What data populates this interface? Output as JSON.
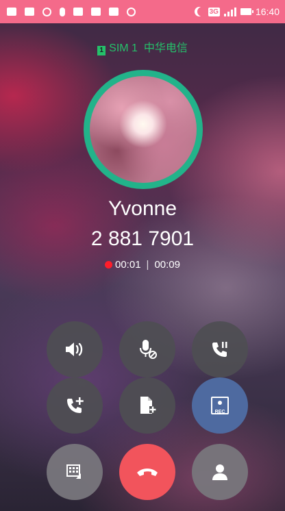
{
  "status_bar": {
    "time": "16:40",
    "network": "3G",
    "left_icons": [
      "chat-icon",
      "media-icon",
      "speed-icon",
      "mic-icon",
      "image-icon",
      "mail-icon",
      "shield-icon",
      "signal-app-icon"
    ]
  },
  "call": {
    "sim_label": "SIM 1",
    "carrier": "中华电信",
    "sim_badge": "1",
    "contact_name": "Yvonne",
    "phone_number": "2 881 7901",
    "recording_time": "00:01",
    "call_time": "00:09"
  },
  "controls": {
    "speaker": "speaker-icon",
    "mute": "mute-mic-icon",
    "hold": "hold-call-icon",
    "add_call": "add-call-icon",
    "note": "add-note-icon",
    "record": "REC",
    "keypad": "keypad-icon",
    "end_call": "end-call-icon",
    "contact": "contact-icon"
  },
  "colors": {
    "status_bar": "#f46a8a",
    "accent_green": "#25c06a",
    "end_call_red": "#f2545c",
    "record_blue": "#4e6aa0"
  }
}
